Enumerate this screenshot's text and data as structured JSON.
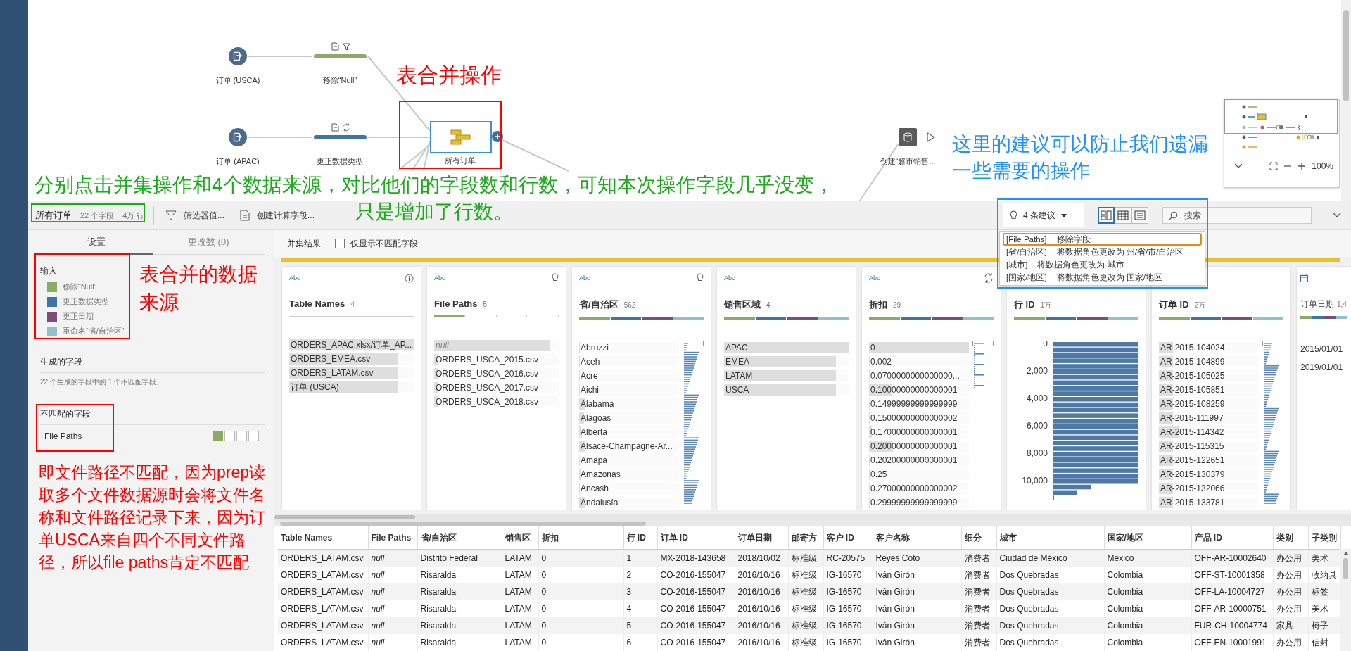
{
  "flow": {
    "nodes": [
      {
        "kind": "input",
        "label": "订单 (USCA)"
      },
      {
        "kind": "clean",
        "label": "移除“Null”",
        "color": "#8aab63"
      },
      {
        "kind": "input",
        "label": "订单 (APAC)"
      },
      {
        "kind": "clean",
        "label": "更正数据类型",
        "color": "#3d76a5"
      },
      {
        "kind": "union",
        "label": "所有订单",
        "selected": true
      },
      {
        "kind": "output",
        "label": "创建“超市销售..."
      }
    ],
    "minimap": {
      "zoom_label": "100%"
    }
  },
  "toolbar": {
    "step_name": "所有订单",
    "field_count": "22 个字段",
    "row_count": "4万 行",
    "actions": [
      {
        "kind": "filter",
        "label": "筛选器值..."
      },
      {
        "kind": "calc",
        "label": "创建计算字段..."
      }
    ],
    "suggestions": {
      "label": "4 条建议",
      "items": [
        {
          "field": "[File Paths]",
          "action": "移除字段",
          "selected": true
        },
        {
          "field": "[省/自治区]",
          "action": "将数据角色更改为 州/省/市/自治区",
          "selected": false
        },
        {
          "field": "[城市]",
          "action": "将数据角色更改为 城市",
          "selected": false
        },
        {
          "field": "[国家/地区]",
          "action": "将数据角色更改为 国家/地区",
          "selected": false
        }
      ]
    },
    "views": [
      {
        "kind": "profile",
        "selected": true
      },
      {
        "kind": "table",
        "selected": false
      },
      {
        "kind": "list",
        "selected": false
      }
    ],
    "search": {
      "placeholder": "搜索"
    }
  },
  "settings_panel": {
    "tabs": [
      {
        "label": "设置",
        "selected": true
      },
      {
        "label": "更改数 (0)",
        "selected": false
      }
    ],
    "inputs_title": "输入",
    "inputs": [
      {
        "label": "移除“Null”",
        "color": "#8aab63"
      },
      {
        "label": "更正数据类型",
        "color": "#3d76a5"
      },
      {
        "label": "更正日期",
        "color": "#7b4f7a"
      },
      {
        "label": "重命名“省/自治区”",
        "color": "#8fc3c9"
      }
    ],
    "generated_title": "生成的字段",
    "generated_note": "22 个生成的字段中的 1 个不匹配字段。",
    "mismatched_title": "不匹配的字段",
    "mismatched": [
      {
        "name": "File Paths",
        "present": [
          true,
          false,
          false,
          false
        ]
      }
    ]
  },
  "profile": {
    "title": "并集结果",
    "filter": {
      "label": "仅显示不匹配字段",
      "checked": false
    },
    "cards": [
      {
        "kind": "list",
        "type": "Abc",
        "name": "Table Names",
        "count": "4",
        "values": [
          {
            "text": "ORDERS_APAC.xlsx/订单_AP...",
            "level": 1
          },
          {
            "text": "ORDERS_EMEA.csv",
            "level": 0.87
          },
          {
            "text": "ORDERS_LATAM.csv",
            "level": 0.87
          },
          {
            "text": "订单 (USCA)",
            "level": 0.87
          }
        ]
      },
      {
        "kind": "list",
        "type": "Abc",
        "name": "File Paths",
        "count": "5",
        "sources": [
          true,
          false,
          false,
          false
        ],
        "values": [
          {
            "text": "null",
            "level": 0.93,
            "is_null": true
          },
          {
            "text": "ORDERS_USCA_2015.csv",
            "level": 0.03
          },
          {
            "text": "ORDERS_USCA_2016.csv",
            "level": 0.03
          },
          {
            "text": "ORDERS_USCA_2017.csv",
            "level": 0.03
          },
          {
            "text": "ORDERS_USCA_2018.csv",
            "level": 0.03
          }
        ]
      },
      {
        "kind": "list",
        "type": "Abc",
        "name": "省/自治区",
        "count": "562",
        "sources": [
          true,
          true,
          true,
          true
        ],
        "mini_histogram": true,
        "values": [
          {
            "text": "Abruzzi",
            "level": 0.01
          },
          {
            "text": "Aceh",
            "level": 0.01
          },
          {
            "text": "Acre",
            "level": 0.01
          },
          {
            "text": "Aichi",
            "level": 0.01
          },
          {
            "text": "Alabama",
            "level": 0.06
          },
          {
            "text": "Alagoas",
            "level": 0.05
          },
          {
            "text": "Alberta",
            "level": 0.02
          },
          {
            "text": "Alsace-Champagne-Ar...",
            "level": 0.06
          },
          {
            "text": "Amapá",
            "level": 0.01
          },
          {
            "text": "Amazonas",
            "level": 0.02
          },
          {
            "text": "Ancash",
            "level": 0.01
          },
          {
            "text": "Andalusía",
            "level": 0.06
          }
        ]
      },
      {
        "kind": "list",
        "type": "Abc",
        "name": "销售区域",
        "count": "4",
        "sources": [
          true,
          true,
          true,
          true
        ],
        "values": [
          {
            "text": "APAC",
            "level": 1
          },
          {
            "text": "EMEA",
            "level": 0.9
          },
          {
            "text": "LATAM",
            "level": 0.9
          },
          {
            "text": "USCA",
            "level": 0.9
          }
        ]
      },
      {
        "kind": "list",
        "type": "Abc",
        "name": "折扣",
        "count": "29",
        "sources": [
          true,
          true,
          true,
          true
        ],
        "mini_histogram": true,
        "values": [
          {
            "text": "0",
            "level": 1
          },
          {
            "text": "0.002",
            "level": 0.01
          },
          {
            "text": "0.0700000000000000...",
            "level": 0.01
          },
          {
            "text": "0.10000000000000001",
            "level": 0.23
          },
          {
            "text": "0.14999999999999999",
            "level": 0.01
          },
          {
            "text": "0.15000000000000002",
            "level": 0.01
          },
          {
            "text": "0.17000000000000001",
            "level": 0.03
          },
          {
            "text": "0.20000000000000001",
            "level": 0.24
          },
          {
            "text": "0.20200000000000001",
            "level": 0.01
          },
          {
            "text": "0.25",
            "level": 0.01
          },
          {
            "text": "0.27000000000000002",
            "level": 0.01
          },
          {
            "text": "0.29999999999999999",
            "level": 0.01
          }
        ]
      },
      {
        "kind": "histogram",
        "name": "行 ID",
        "count": "1万",
        "sources": [
          true,
          true,
          true,
          true
        ],
        "bin_labels": [
          "0",
          "2,000",
          "4,000",
          "6,000",
          "8,000",
          "10,000"
        ]
      },
      {
        "kind": "list",
        "name": "订单 ID",
        "count": "2万",
        "sources": [
          true,
          true,
          true,
          true
        ],
        "mini_histogram": true,
        "values": [
          {
            "text": "AR-2015-104024",
            "level": 0.14
          },
          {
            "text": "AR-2015-104899",
            "level": 0.14
          },
          {
            "text": "AR-2015-105025",
            "level": 0.14
          },
          {
            "text": "AR-2015-105851",
            "level": 0.14
          },
          {
            "text": "AR-2015-108259",
            "level": 0.14
          },
          {
            "text": "AR-2015-111997",
            "level": 0.14
          },
          {
            "text": "AR-2015-114342",
            "level": 0.2
          },
          {
            "text": "AR-2015-115315",
            "level": 0.14
          },
          {
            "text": "AR-2015-122651",
            "level": 0.14
          },
          {
            "text": "AR-2015-130379",
            "level": 0.14
          },
          {
            "text": "AR-2015-132066",
            "level": 0.14
          },
          {
            "text": "AR-2015-133781",
            "level": 0.14
          }
        ]
      },
      {
        "kind": "dates",
        "name": "订单日期",
        "count": "1,4",
        "sources": [
          true,
          true,
          true,
          true
        ],
        "values": [
          {
            "text": "2015/01/01"
          },
          {
            "text": "2019/01/01"
          }
        ]
      }
    ]
  },
  "table": {
    "columns": [
      {
        "label": "Table Names"
      },
      {
        "label": "File Paths",
        "italic": true
      },
      {
        "label": "省/自治区"
      },
      {
        "label": "销售区"
      },
      {
        "label": "折扣"
      },
      {
        "label": "行 ID"
      },
      {
        "label": "订单 ID"
      },
      {
        "label": "订单日期"
      },
      {
        "label": "邮寄方"
      },
      {
        "label": "客户 ID"
      },
      {
        "label": "客户名称"
      },
      {
        "label": "细分"
      },
      {
        "label": "城市"
      },
      {
        "label": "国家/地区"
      },
      {
        "label": "产品 ID"
      },
      {
        "label": "类别"
      },
      {
        "label": "子类别"
      }
    ],
    "rows": [
      [
        "ORDERS_LATAM.csv",
        "null",
        "Distrito Federal",
        "LATAM",
        "0",
        "1",
        "MX-2018-143658",
        "2018/10/02",
        "标准级",
        "RC-20575",
        "Reyes Coto",
        "消费者",
        "Ciudad de México",
        "Mexico",
        "OFF-AR-10002640",
        "办公用",
        "美术"
      ],
      [
        "ORDERS_LATAM.csv",
        "null",
        "Risaralda",
        "LATAM",
        "0",
        "2",
        "CO-2016-155047",
        "2016/10/16",
        "标准级",
        "IG-16570",
        "Iván Girón",
        "消费者",
        "Dos Quebradas",
        "Colombia",
        "OFF-ST-10001358",
        "办公用",
        "收纳具"
      ],
      [
        "ORDERS_LATAM.csv",
        "null",
        "Risaralda",
        "LATAM",
        "0",
        "3",
        "CO-2016-155047",
        "2016/10/16",
        "标准级",
        "IG-16570",
        "Iván Girón",
        "消费者",
        "Dos Quebradas",
        "Colombia",
        "OFF-LA-10004727",
        "办公用",
        "标签"
      ],
      [
        "ORDERS_LATAM.csv",
        "null",
        "Risaralda",
        "LATAM",
        "0",
        "4",
        "CO-2016-155047",
        "2016/10/16",
        "标准级",
        "IG-16570",
        "Iván Girón",
        "消费者",
        "Dos Quebradas",
        "Colombia",
        "OFF-AR-10000751",
        "办公用",
        "美术"
      ],
      [
        "ORDERS_LATAM.csv",
        "null",
        "Risaralda",
        "LATAM",
        "0",
        "5",
        "CO-2016-155047",
        "2016/10/16",
        "标准级",
        "IG-16570",
        "Iván Girón",
        "消费者",
        "Dos Quebradas",
        "Colombia",
        "FUR-CH-10004774",
        "家具",
        "椅子"
      ],
      [
        "ORDERS_LATAM.csv",
        "null",
        "Risaralda",
        "LATAM",
        "0",
        "6",
        "CO-2016-155047",
        "2016/10/16",
        "标准级",
        "IG-16570",
        "Iván Girón",
        "消费者",
        "Dos Quebradas",
        "Colombia",
        "OFF-EN-10001991",
        "办公用",
        "信封"
      ]
    ]
  },
  "annotations": [
    {
      "kind": "text",
      "text": "表合并操作",
      "color": "#ff0000"
    },
    {
      "kind": "box",
      "color": "#ff0000"
    },
    {
      "kind": "text",
      "text": "分别点击并集操作和4个数据来源，对比他们的字段数和行数，可知本次操作字段几乎没变，",
      "color": "#1aab1a"
    },
    {
      "kind": "text",
      "text": "只是增加了行数。",
      "color": "#1aab1a"
    },
    {
      "kind": "box",
      "color": "#1aab1a"
    },
    {
      "kind": "text",
      "text": "这里的建议可以防止我们遗漏一些需要的操作",
      "color": "#1e90ff"
    },
    {
      "kind": "box",
      "color": "#1e90ff"
    },
    {
      "kind": "box",
      "color": "#ff0000"
    },
    {
      "kind": "text",
      "text": "表合并的数据来源",
      "color": "#ff0000"
    },
    {
      "kind": "box",
      "color": "#ff0000"
    },
    {
      "kind": "text",
      "text": "即文件路径不匹配，因为prep读取多个文件数据源时会将文件名称和文件路径记录下来，因为订单USCA来自四个不同文件路径，所以file paths肯定不匹配",
      "color": "#ff0000"
    }
  ]
}
